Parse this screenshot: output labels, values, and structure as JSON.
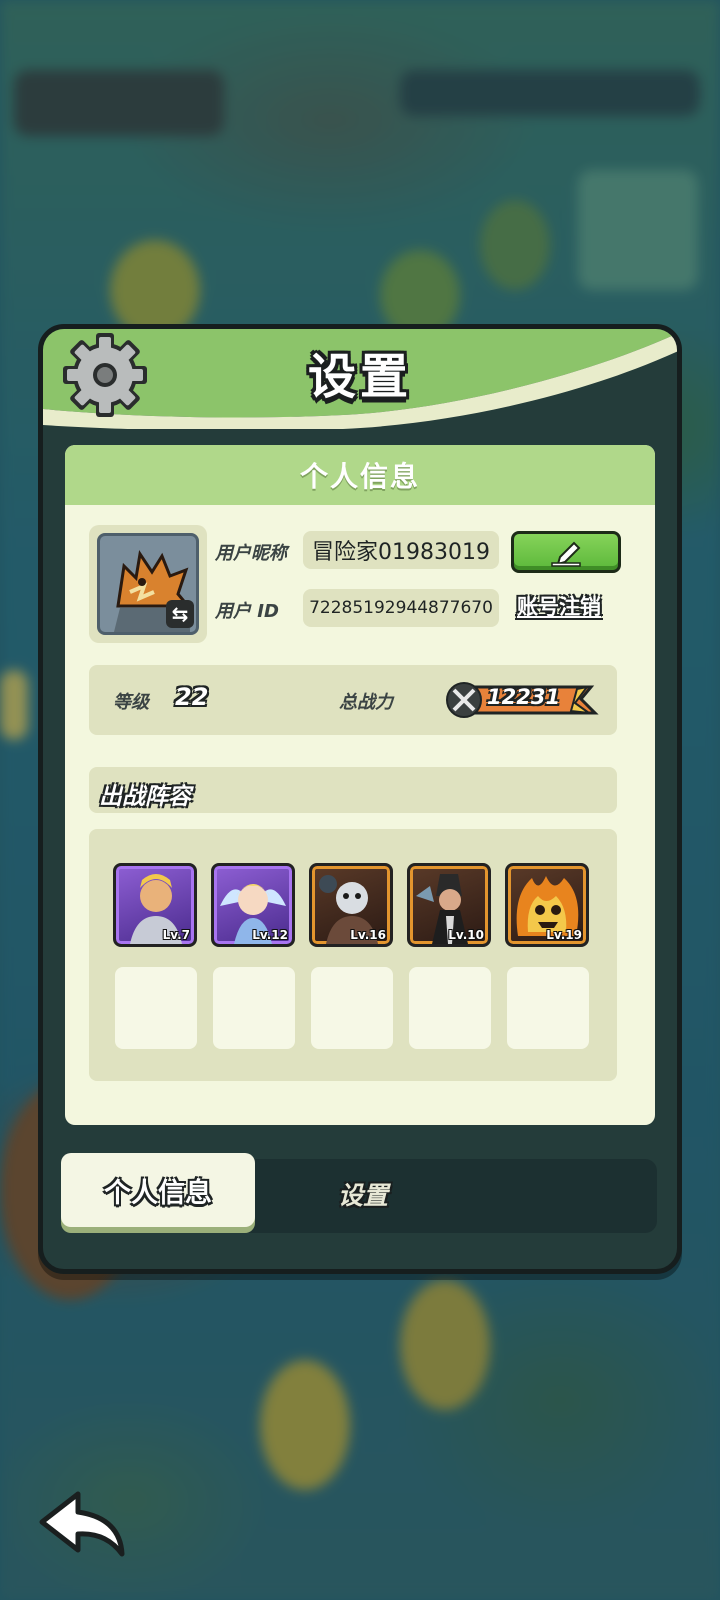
{
  "dialog": {
    "title": "设置",
    "icon": "gear-icon"
  },
  "info_card": {
    "header": "个人信息",
    "nickname_label": "用户昵称",
    "nickname_value": "冒险家01983019",
    "user_id_label": "用户 ID",
    "user_id_value": "72285192944877670",
    "edit_icon": "pencil-icon",
    "cancel_account_label": "账号注销",
    "level_label": "等级",
    "level_value": "22",
    "power_label": "总战力",
    "power_value": "12231",
    "lineup_title": "出战阵容",
    "heroes": [
      {
        "level": "Lv.7",
        "rarity": "purple"
      },
      {
        "level": "Lv.12",
        "rarity": "purple"
      },
      {
        "level": "Lv.16",
        "rarity": "orange"
      },
      {
        "level": "Lv.10",
        "rarity": "orange"
      },
      {
        "level": "Lv.19",
        "rarity": "orange"
      }
    ]
  },
  "tabs": [
    {
      "label": "个人信息",
      "active": true
    },
    {
      "label": "设置",
      "active": false
    }
  ],
  "colors": {
    "header_green": "#b0d88a",
    "card_bg": "#f3f7de",
    "edit_button_green": "#5cb83a",
    "purple_rarity": "#a874f0",
    "orange_rarity": "#e3952e"
  }
}
